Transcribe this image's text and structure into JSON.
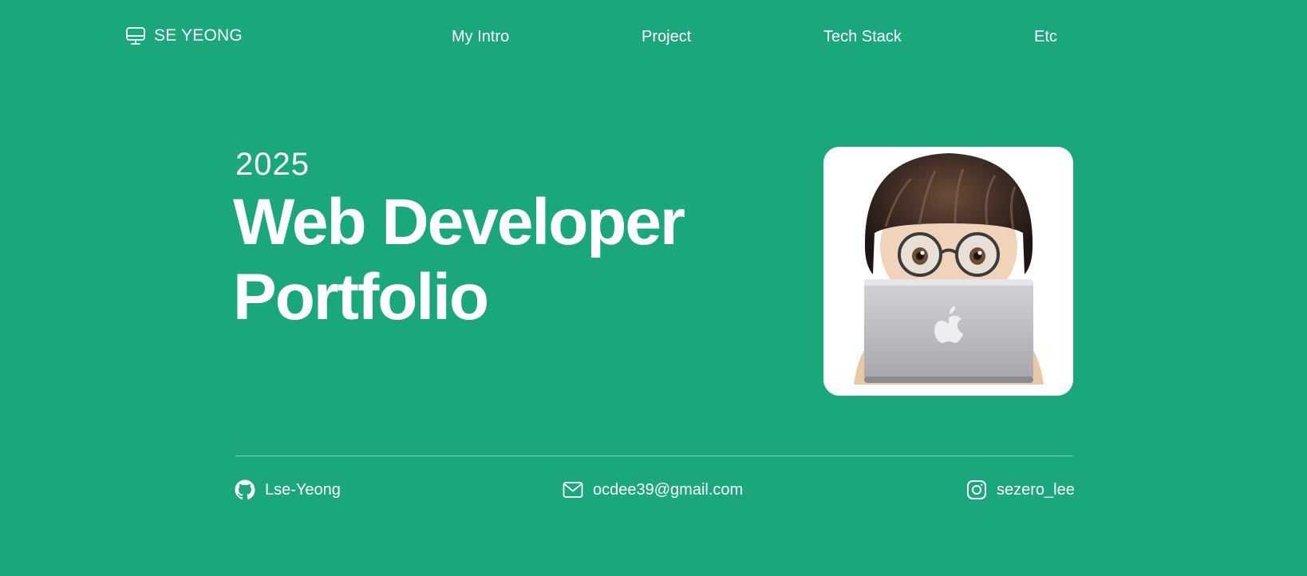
{
  "header": {
    "brand": {
      "name": "SE YEONG",
      "icon": "monitor-icon"
    },
    "nav": [
      {
        "label": "My Intro"
      },
      {
        "label": "Project"
      },
      {
        "label": "Tech Stack"
      },
      {
        "label": "Etc"
      }
    ]
  },
  "hero": {
    "year": "2025",
    "title_line1": "Web Developer",
    "title_line2": "Portfolio",
    "avatar": {
      "icon": "memoji-avatar-with-laptop"
    }
  },
  "contacts": {
    "github": {
      "icon": "github-icon",
      "label": "Lse-Yeong"
    },
    "email": {
      "icon": "mail-icon",
      "label": "ocdee39@gmail.com"
    },
    "instagram": {
      "icon": "instagram-icon",
      "label": "sezero_lee"
    }
  },
  "colors": {
    "background": "#1aa77b",
    "text": "#ffffff",
    "card": "#ffffff"
  }
}
